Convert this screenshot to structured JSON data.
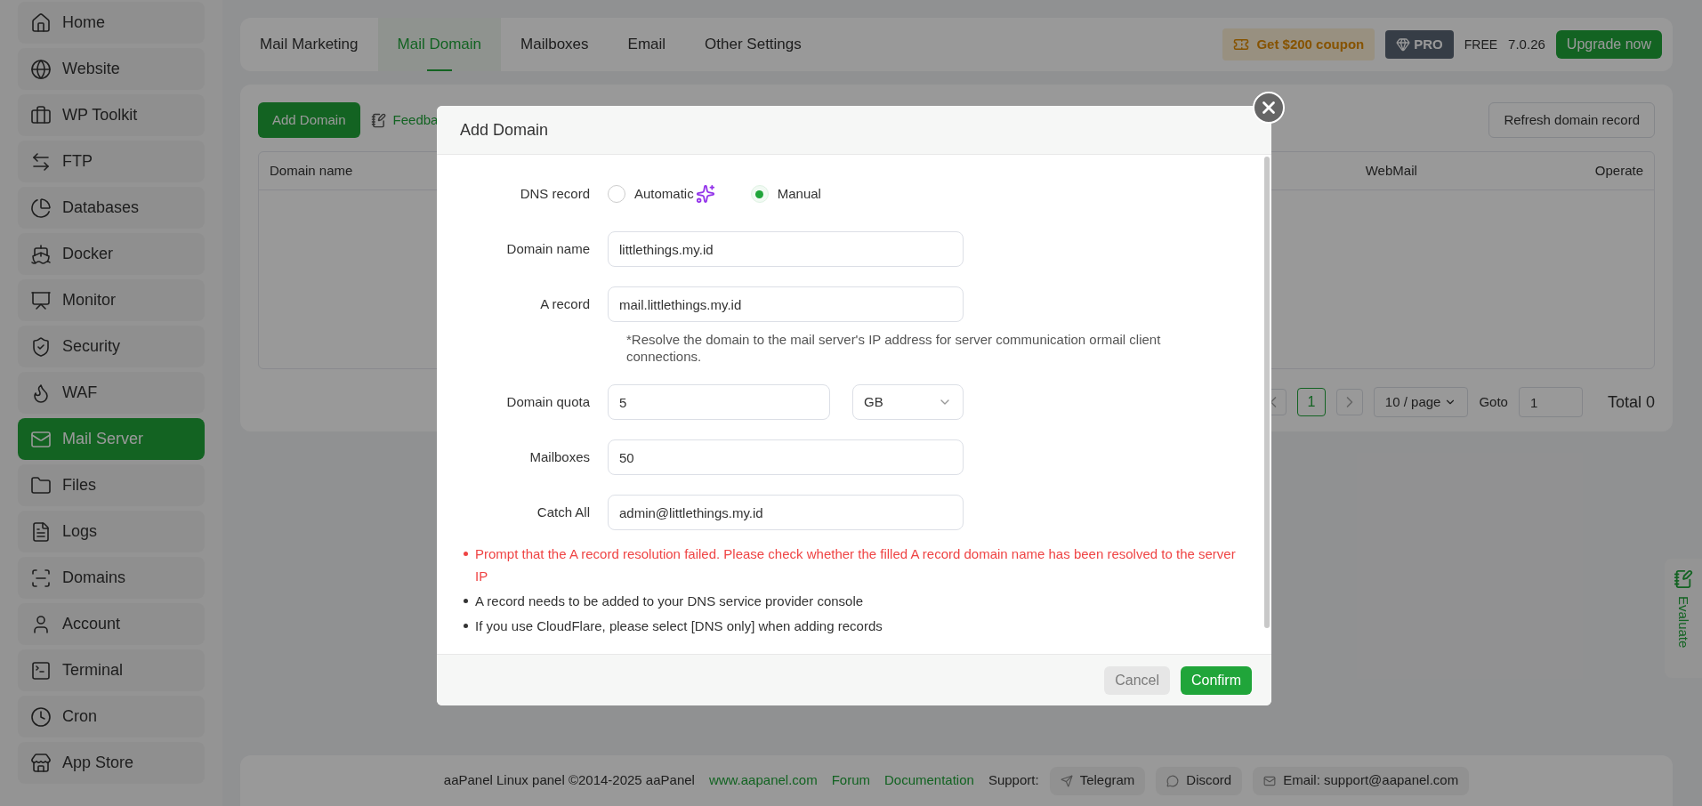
{
  "sidebar": {
    "items": [
      {
        "label": "Home",
        "selected": false
      },
      {
        "label": "Website",
        "selected": false
      },
      {
        "label": "WP Toolkit",
        "selected": false
      },
      {
        "label": "FTP",
        "selected": false
      },
      {
        "label": "Databases",
        "selected": false
      },
      {
        "label": "Docker",
        "selected": false
      },
      {
        "label": "Monitor",
        "selected": false
      },
      {
        "label": "Security",
        "selected": false
      },
      {
        "label": "WAF",
        "selected": false
      },
      {
        "label": "Mail Server",
        "selected": true
      },
      {
        "label": "Files",
        "selected": false
      },
      {
        "label": "Logs",
        "selected": false
      },
      {
        "label": "Domains",
        "selected": false
      },
      {
        "label": "Account",
        "selected": false
      },
      {
        "label": "Terminal",
        "selected": false
      },
      {
        "label": "Cron",
        "selected": false
      },
      {
        "label": "App Store",
        "selected": false
      }
    ]
  },
  "tabs": [
    {
      "label": "Mail Marketing",
      "selected": false
    },
    {
      "label": "Mail Domain",
      "selected": true
    },
    {
      "label": "Mailboxes",
      "selected": false
    },
    {
      "label": "Email",
      "selected": false
    },
    {
      "label": "Other Settings",
      "selected": false
    }
  ],
  "header": {
    "coupon": "Get $200 coupon",
    "pro_badge": "PRO",
    "edition": "FREE",
    "version": "7.0.26",
    "upgrade_button": "Upgrade now"
  },
  "toolbar": {
    "add_button": "Add Domain",
    "feedback_link": "Feedba",
    "refresh_button": "Refresh domain record"
  },
  "table": {
    "columns": [
      "Domain name",
      "WebMail",
      "Operate"
    ]
  },
  "pagination": {
    "current_page": "1",
    "page_size": "10 / page",
    "goto_label": "Goto",
    "goto_value": "1",
    "total": "Total 0"
  },
  "dialog": {
    "title": "Add Domain",
    "dns_record": {
      "label": "DNS record",
      "options": [
        {
          "label": "Automatic",
          "selected": false
        },
        {
          "label": "Manual",
          "selected": true
        }
      ]
    },
    "domain_name": {
      "label": "Domain name",
      "value": "littlethings.my.id"
    },
    "a_record": {
      "label": "A record",
      "value": "mail.littlethings.my.id",
      "hint": "*Resolve the domain to the mail server's IP address for server communication ormail client connections."
    },
    "domain_quota": {
      "label": "Domain quota",
      "value": "5",
      "unit": "GB"
    },
    "mailboxes": {
      "label": "Mailboxes",
      "value": "50"
    },
    "catch_all": {
      "label": "Catch All",
      "value": "admin@littlethings.my.id"
    },
    "notes": [
      {
        "kind": "error",
        "text": "Prompt that the A record resolution failed. Please check whether the filled A record domain name has been resolved to the server IP"
      },
      {
        "kind": "info",
        "text": "A record needs to be added to your DNS service provider console"
      },
      {
        "kind": "info",
        "text": "If you use CloudFlare, please select [DNS only] when adding records"
      }
    ],
    "cancel_button": {
      "label": "Cancel",
      "disabled": true
    },
    "confirm_button": "Confirm"
  },
  "evaluate_tab": "Evaluate",
  "footer": {
    "copyright": "aaPanel Linux panel ©2014-2025 aaPanel",
    "links": [
      "www.aapanel.com",
      "Forum",
      "Documentation"
    ],
    "support_label": "Support:",
    "support": [
      "Telegram",
      "Discord",
      "Email: support@aapanel.com"
    ]
  }
}
